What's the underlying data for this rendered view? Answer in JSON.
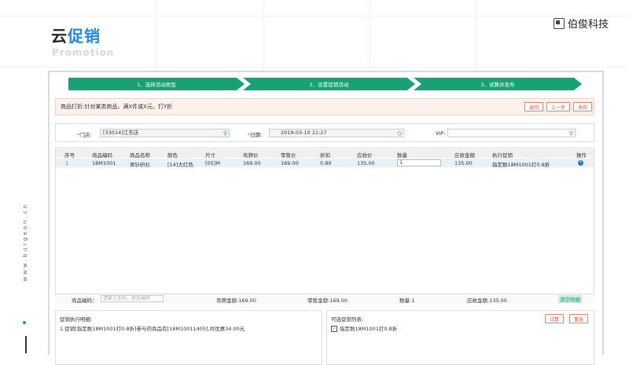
{
  "brand": {
    "title_a": "云",
    "title_b": "促销",
    "subtitle": "Promotion",
    "company": "伯俊科技",
    "vertical_url": "www.burgeon.cn"
  },
  "steps": [
    "1、选择活动类型",
    "2、设置促销活动",
    "3、试算并发布"
  ],
  "notice": {
    "text": "商品打折:针对某类商品，满X件或X元，打Y折",
    "buttons": {
      "back": "返回",
      "prev": "上一步",
      "publish": "发布"
    }
  },
  "filters": {
    "store_label": "门店:",
    "store_value": "[33014]江东店",
    "date_label": "日期:",
    "date_value": "2019-03-10 21:27",
    "vip_label": "VIP:",
    "vip_value": ""
  },
  "table": {
    "headers": [
      "序号",
      "商品编码",
      "商品名称",
      "颜色",
      "尺寸",
      "吊牌价",
      "零售价",
      "折扣",
      "应收价",
      "数量",
      "应收金额",
      "执行促销",
      "操作"
    ],
    "rows": [
      {
        "no": "1",
        "code": "18M1001",
        "name": "男针织衫",
        "color": "[14]大红色",
        "size": "[05]M",
        "tag_price": "169.00",
        "retail_price": "169.00",
        "discount": "0.80",
        "receivable_price": "135.00",
        "qty": "1",
        "amount": "135.00",
        "promotion": "指定数18M1001打0.8折"
      }
    ]
  },
  "summary": {
    "code_label": "商品编码：",
    "code_placeholder": "请输入条码，商品编码",
    "tag_total": "吊牌金额:169.00",
    "retail_total": "零售金额:169.00",
    "qty_total": "数量:1",
    "receivable_total": "应收金额:135.00",
    "clear_button": "清空明细"
  },
  "detail_panel": {
    "title": "促销执行明细:",
    "line": "1.促销[指定数18M1001打0.8折]参与的商品有[18M10011405],共优惠34.00元"
  },
  "promo_panel": {
    "title": "可选促销列表:",
    "item": "指定数18M1001打0.8折",
    "buttons": {
      "calc": "试算",
      "reselect": "重选"
    }
  },
  "colors": {
    "accent_green": "#1aa173",
    "accent_red": "#e0523a",
    "brand_blue": "#1e88e5"
  }
}
